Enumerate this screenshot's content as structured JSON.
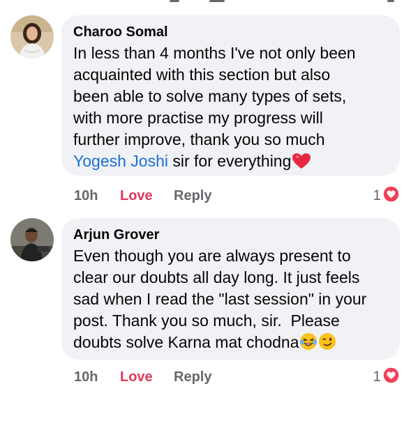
{
  "comments": [
    {
      "author": "Charoo Somal",
      "text_before": "In less than 4 months I've not only been\nacquainted with this section but also\nbeen able to solve many types of sets,\nwith more practise my progress will\nfurther improve, thank you so much\n",
      "mention": "Yogesh Joshi",
      "text_after": " sir for everything",
      "emojis": [
        "red-heart"
      ],
      "time": "10h",
      "love_label": "Love",
      "reply_label": "Reply",
      "reaction_count": "1",
      "reaction_type": "love"
    },
    {
      "author": "Arjun Grover",
      "text_before": "Even though you are always present to\nclear our doubts all day long. It just feels\nsad when I read the \"last session\" in your\npost. Thank you so much, sir.  Please\ndoubts solve Karna mat chodna",
      "mention": "",
      "text_after": "",
      "emojis": [
        "laughing-tears",
        "winking-face"
      ],
      "time": "10h",
      "love_label": "Love",
      "reply_label": "Reply",
      "reaction_count": "1",
      "reaction_type": "love"
    }
  ],
  "colors": {
    "bubble": "#f0f2f5",
    "love": "#e0395a",
    "mention": "#1b6fd6",
    "meta": "#65676b",
    "heart": "#e8283f"
  }
}
